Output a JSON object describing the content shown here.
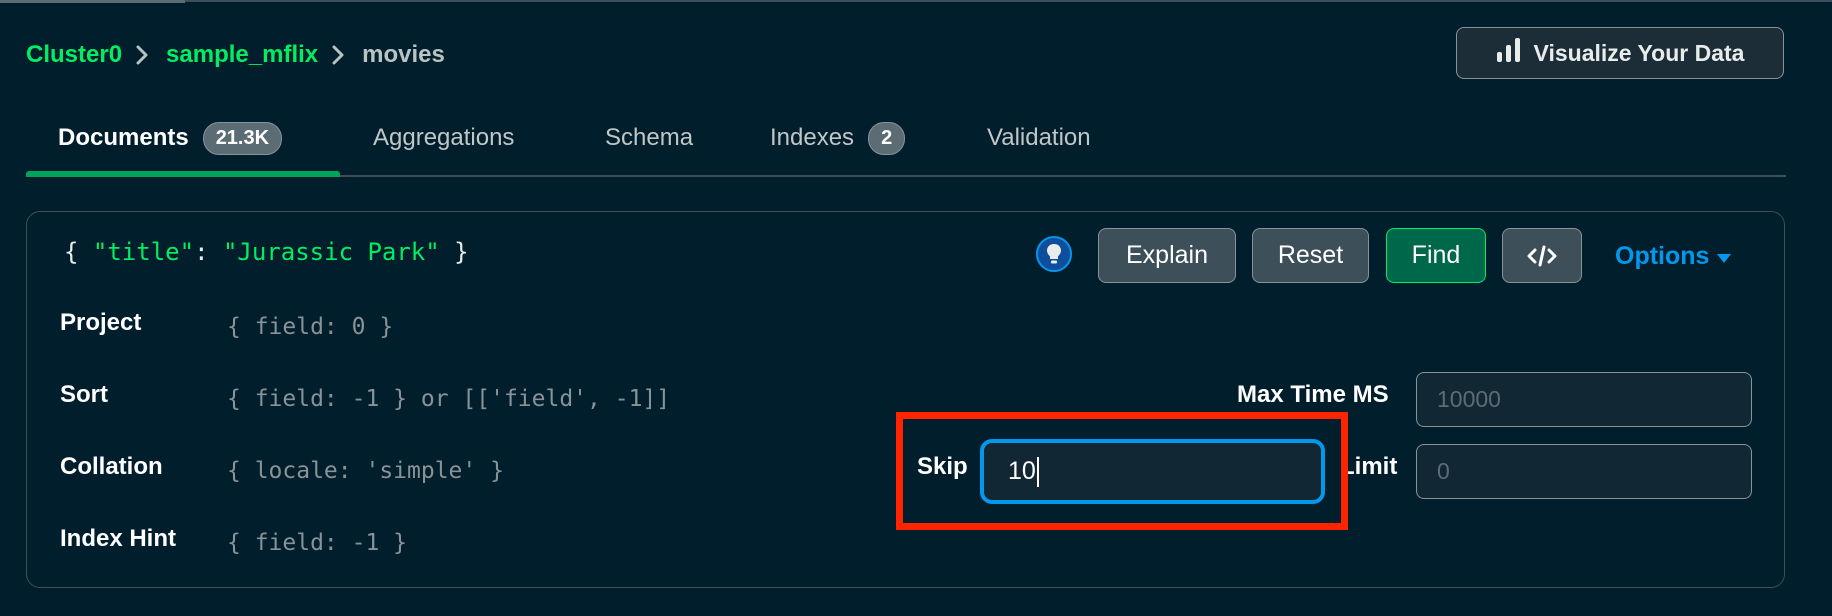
{
  "breadcrumb": {
    "cluster": "Cluster0",
    "database": "sample_mflix",
    "collection": "movies"
  },
  "header": {
    "visualize_label": "Visualize Your Data"
  },
  "tabs": [
    {
      "label": "Documents",
      "badge": "21.3K"
    },
    {
      "label": "Aggregations"
    },
    {
      "label": "Schema"
    },
    {
      "label": "Indexes",
      "badge": "2"
    },
    {
      "label": "Validation"
    }
  ],
  "query": {
    "filter_open": "{",
    "filter_key": "\"title\"",
    "filter_colon": ":",
    "filter_value": "\"Jurassic Park\"",
    "filter_close": "}",
    "buttons": {
      "explain": "Explain",
      "reset": "Reset",
      "find": "Find",
      "options": "Options"
    },
    "project_label": "Project",
    "project_placeholder": "{ field: 0 }",
    "sort_label": "Sort",
    "sort_placeholder": "{ field: -1 } or [['field', -1]]",
    "collation_label": "Collation",
    "collation_placeholder": "{ locale: 'simple' }",
    "hint_label": "Index Hint",
    "hint_placeholder": "{ field: -1 }",
    "maxtime_label": "Max Time MS",
    "maxtime_placeholder": "10000",
    "skip_label": "Skip",
    "skip_value": "10",
    "limit_label": "Limit",
    "limit_placeholder": "0"
  },
  "colors": {
    "background": "#001e2b",
    "accent_green": "#00ed64",
    "focus_blue": "#0498ec",
    "highlight_red": "#ff2400"
  }
}
